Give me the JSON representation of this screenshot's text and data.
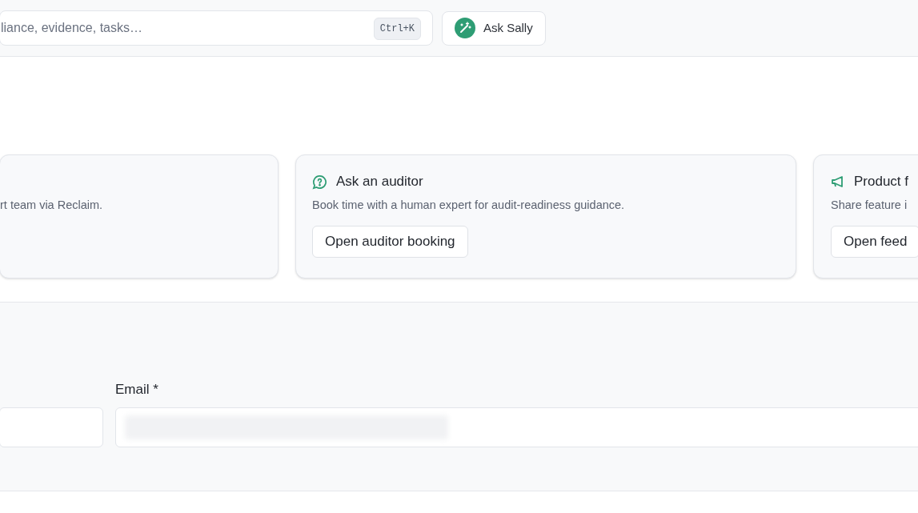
{
  "top_bar": {
    "search": {
      "placeholder": "liance, evidence, tasks…",
      "shortcut": "Ctrl+K"
    },
    "assistant_button": "Ask Sally"
  },
  "cards": [
    {
      "description": "rt team via Reclaim."
    },
    {
      "title": "Ask an auditor",
      "description": "Book time with a human expert for audit-readiness guidance.",
      "button": "Open auditor booking",
      "kind": "auditor"
    },
    {
      "title": "Product f",
      "description": "Share feature i",
      "button": "Open feed",
      "kind": "feedback"
    }
  ],
  "form": {
    "fields": [
      {
        "kind": "text"
      },
      {
        "kind": "email",
        "label": "Email *",
        "redacted": true
      }
    ]
  }
}
